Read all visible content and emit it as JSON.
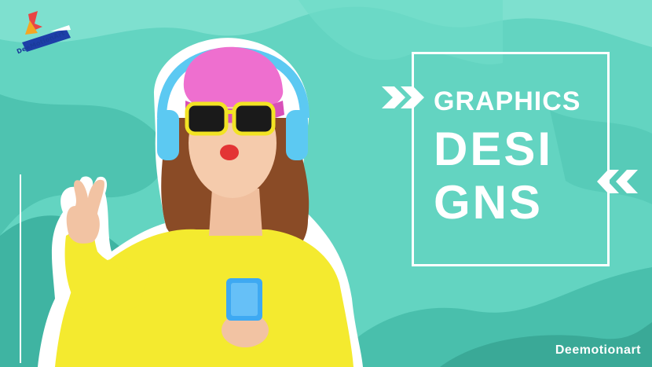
{
  "logo": {
    "text": "DeeMotionArt"
  },
  "title": {
    "line1": "GRAPHICS",
    "line2": "DESI",
    "line3": "GNS"
  },
  "brand": {
    "name": "Deemotionart"
  },
  "icons": {
    "chevron_right": "double-chevron-right-icon",
    "chevron_left": "double-chevron-left-icon"
  },
  "colors": {
    "background": "#5fd2be",
    "wave_dark": "#3fb8a6",
    "sweater": "#f4ea2f",
    "hat": "#ee6fcf",
    "glasses": "#f2e324",
    "headphones": "#5cc9f2",
    "phone": "#3ea9f2",
    "hair": "#8a4b26",
    "lips": "#e33434",
    "text": "#ffffff"
  }
}
